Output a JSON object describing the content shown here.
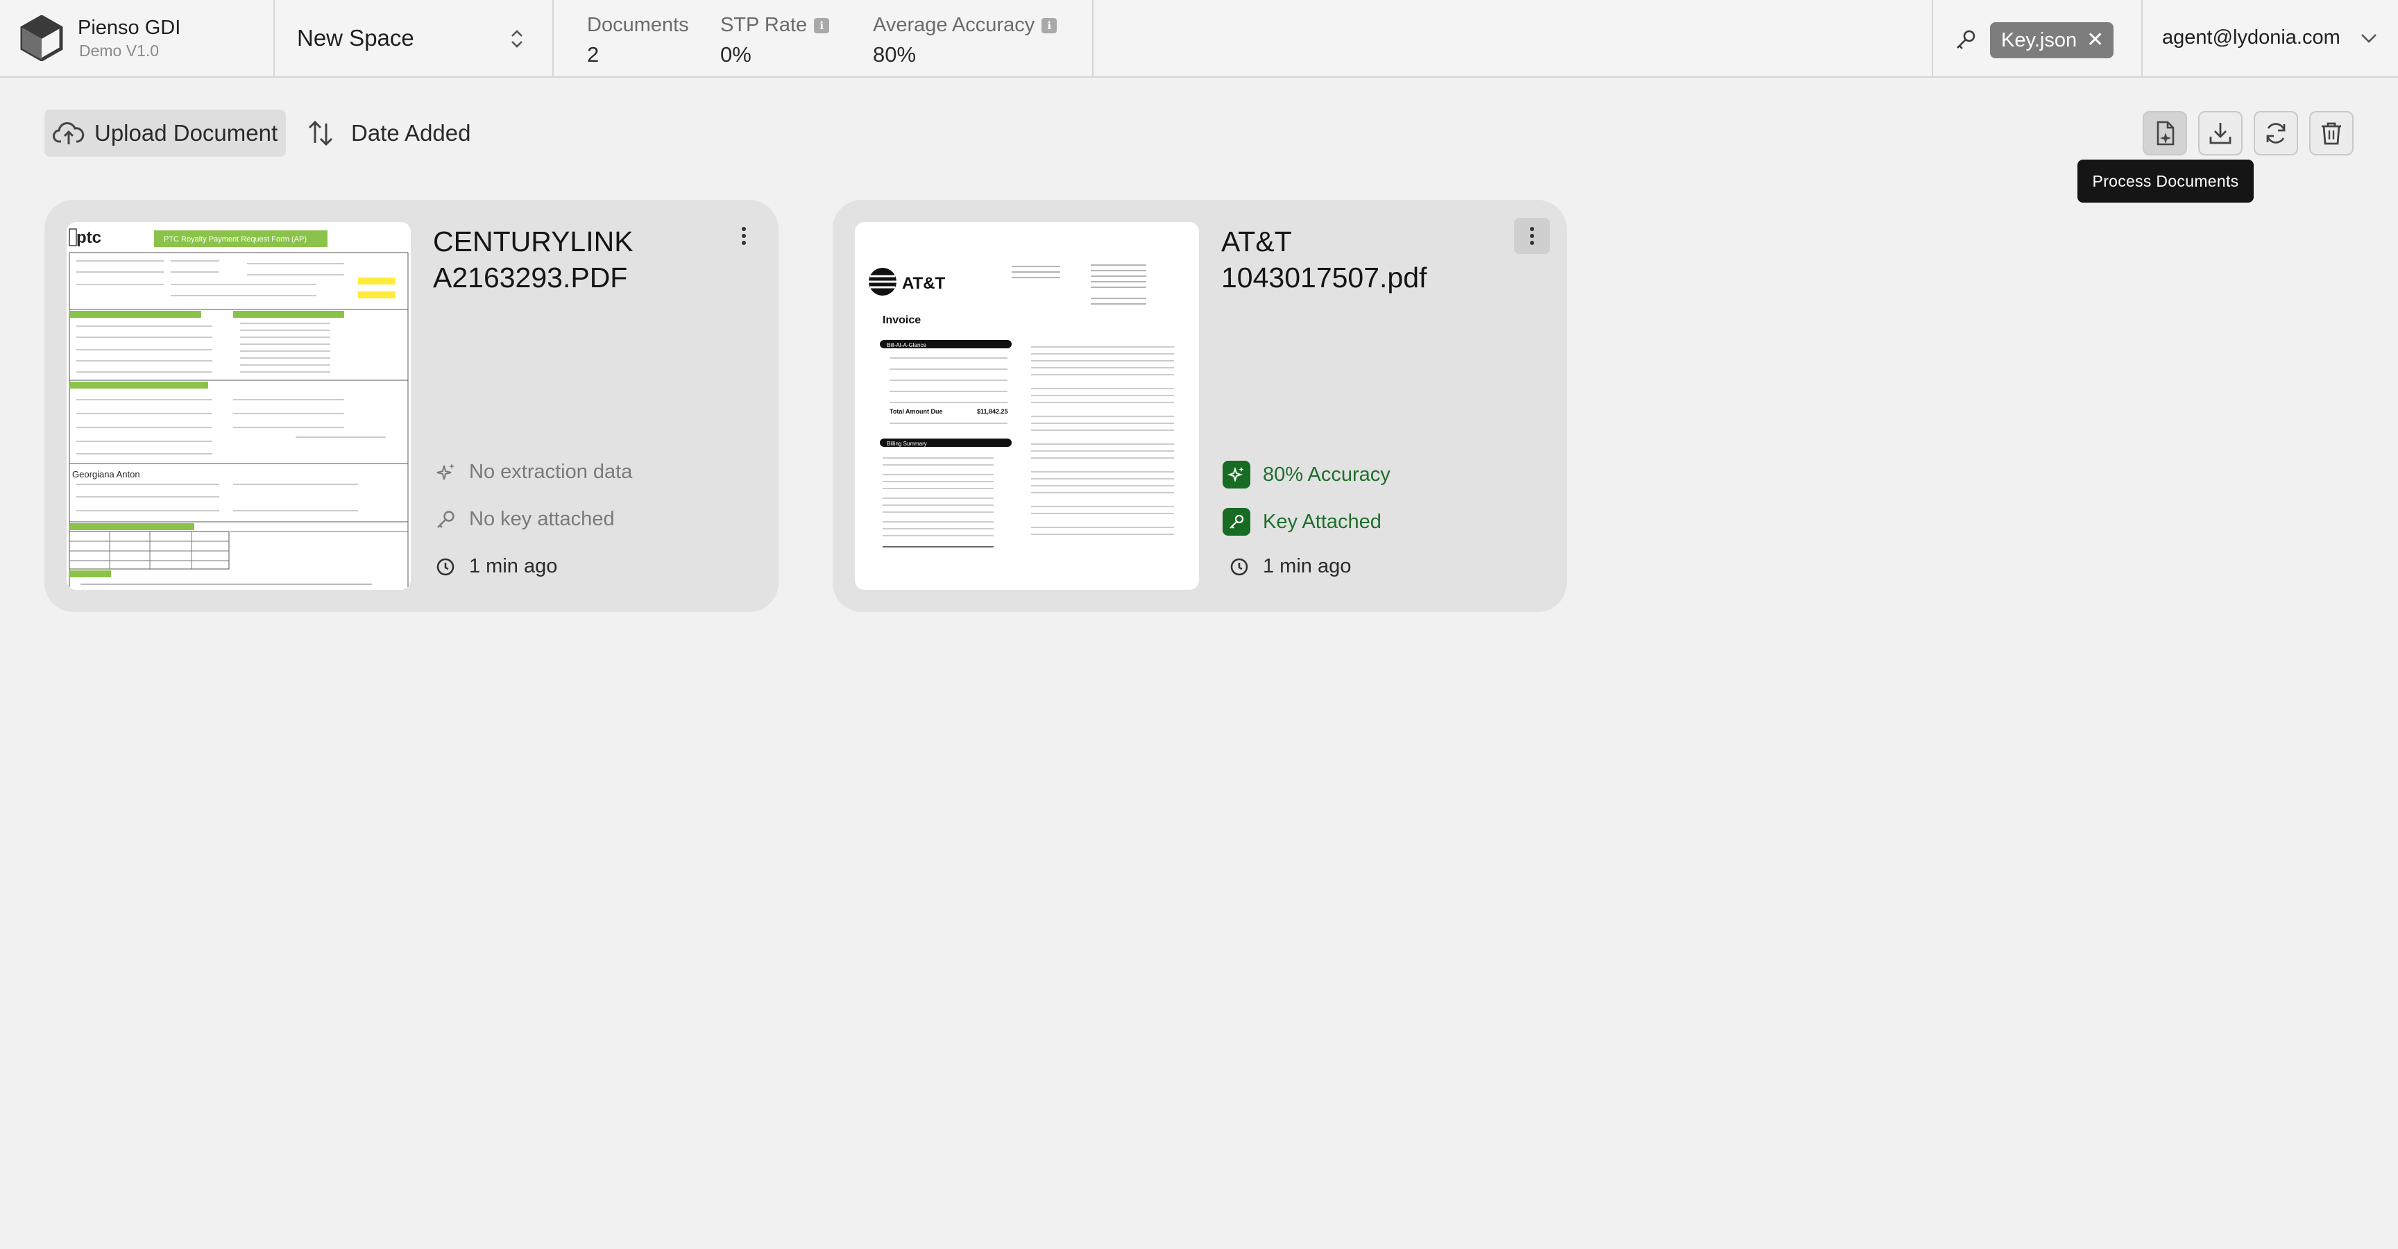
{
  "header": {
    "app_name": "Pienso GDI",
    "version": "Demo V1.0",
    "space_name": "New Space",
    "stats": [
      {
        "label": "Documents",
        "value": "2",
        "info": false
      },
      {
        "label": "STP Rate",
        "value": "0%",
        "info": true
      },
      {
        "label": "Average Accuracy",
        "value": "80%",
        "info": true
      }
    ],
    "key_file": "Key.json",
    "user_email": "agent@lydonia.com"
  },
  "toolbar": {
    "upload_label": "Upload Document",
    "sort_label": "Date Added",
    "tooltip": "Process Documents",
    "actions": [
      "process-documents",
      "download",
      "refresh",
      "delete"
    ]
  },
  "documents": [
    {
      "title": "CENTURYLINK A2163293.PDF",
      "extraction": "No extraction data",
      "key_status": "No key attached",
      "time": "1 min ago",
      "thumbnail": {
        "logo": "ptc",
        "header": "PTC Royalty Payment Request Form (AP)",
        "person": "Georgiana Anton"
      }
    },
    {
      "title": "AT&T 1043017507.pdf",
      "extraction": "80% Accuracy",
      "key_status": "Key Attached",
      "time": "1 min ago",
      "thumbnail": {
        "logo": "AT&T",
        "heading": "Invoice",
        "total_label": "Total Amount Due",
        "total_value": "$11,842.25",
        "bill_section": "Bill-At-A-Glance",
        "billing_section": "Billing Summary"
      }
    }
  ],
  "colors": {
    "accent_green": "#186b22",
    "ptc_green": "#8bc34a",
    "chip_grey": "#7d7d7d"
  }
}
